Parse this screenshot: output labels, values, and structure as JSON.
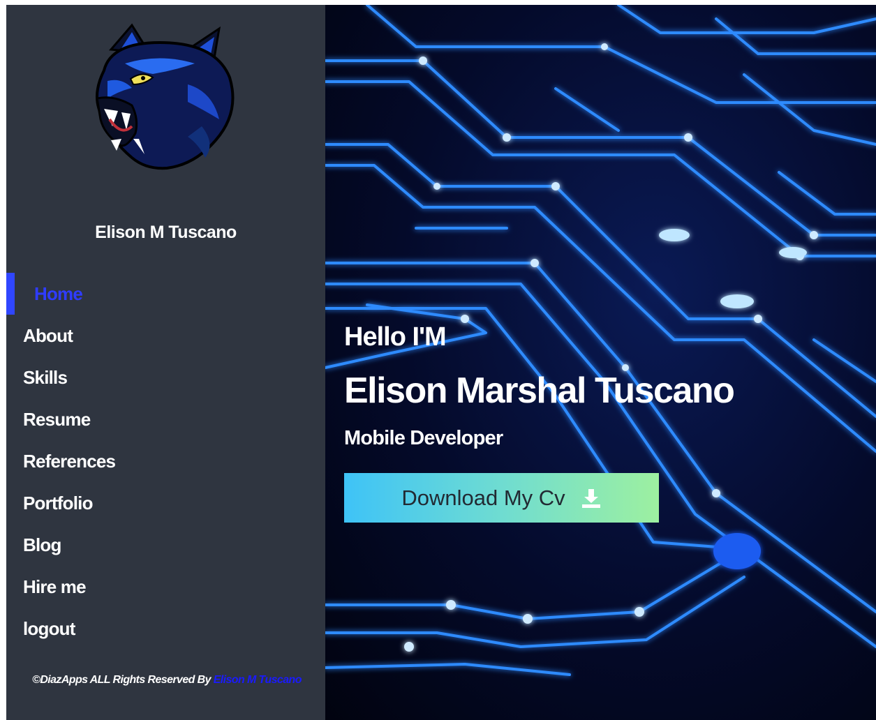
{
  "sidebar": {
    "logo_icon": "panther-logo-icon",
    "owner_name": "Elison M Tuscano",
    "nav_items": [
      {
        "label": "Home",
        "active": true
      },
      {
        "label": "About",
        "active": false
      },
      {
        "label": "Skills",
        "active": false
      },
      {
        "label": "Resume",
        "active": false
      },
      {
        "label": "References",
        "active": false
      },
      {
        "label": "Portfolio",
        "active": false
      },
      {
        "label": "Blog",
        "active": false
      },
      {
        "label": "Hire me",
        "active": false
      },
      {
        "label": "logout",
        "active": false
      }
    ],
    "footer": {
      "text": "©DiazApps ALL Rights Reserved By ",
      "link_text": "Elison M Tuscano"
    }
  },
  "hero": {
    "greeting": "Hello I'M",
    "full_name": "Elison Marshal Tuscano",
    "job_title": "Mobile Developer",
    "cv_button_label": "Download My Cv",
    "cv_button_icon": "download-icon"
  },
  "colors": {
    "sidebar_bg": "#2f3540",
    "active_nav": "#2f3cff",
    "footer_link": "#1a1aff",
    "button_gradient_start": "#3ec3f7",
    "button_gradient_end": "#9df0a0"
  }
}
